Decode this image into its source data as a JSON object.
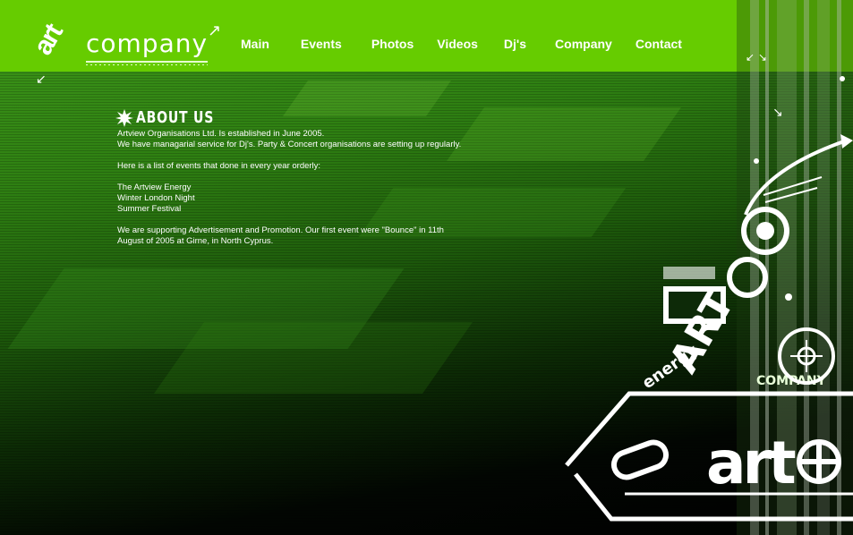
{
  "site": {
    "logo_mark": "art",
    "logo_text": "company"
  },
  "nav": {
    "items": [
      "Main",
      "Events",
      "Photos",
      "Videos",
      "Dj's",
      "Company",
      "Contact"
    ]
  },
  "about": {
    "title": "ABOUT US",
    "line1": "Artview Organisations Ltd. Is established in June 2005.",
    "line2": "We have managarial service for Dj's. Party & Concert organisations are setting up regularly.",
    "line3": "Here is a list of events that done in every year orderly:",
    "events": [
      "The Artview Energy",
      "Winter London Night",
      "Summer Festival"
    ],
    "line4a": "We are supporting Advertisement and Promotion. Our first event were \"Bounce\" in 11th",
    "line4b": "August of 2005 at Girne, in North Cyprus."
  },
  "art": {
    "word_energy": "energy",
    "word_art": "ART",
    "word_company": "COMPANY",
    "logo_big": "art"
  },
  "colors": {
    "header": "#66cc00",
    "text": "#ffffff"
  }
}
